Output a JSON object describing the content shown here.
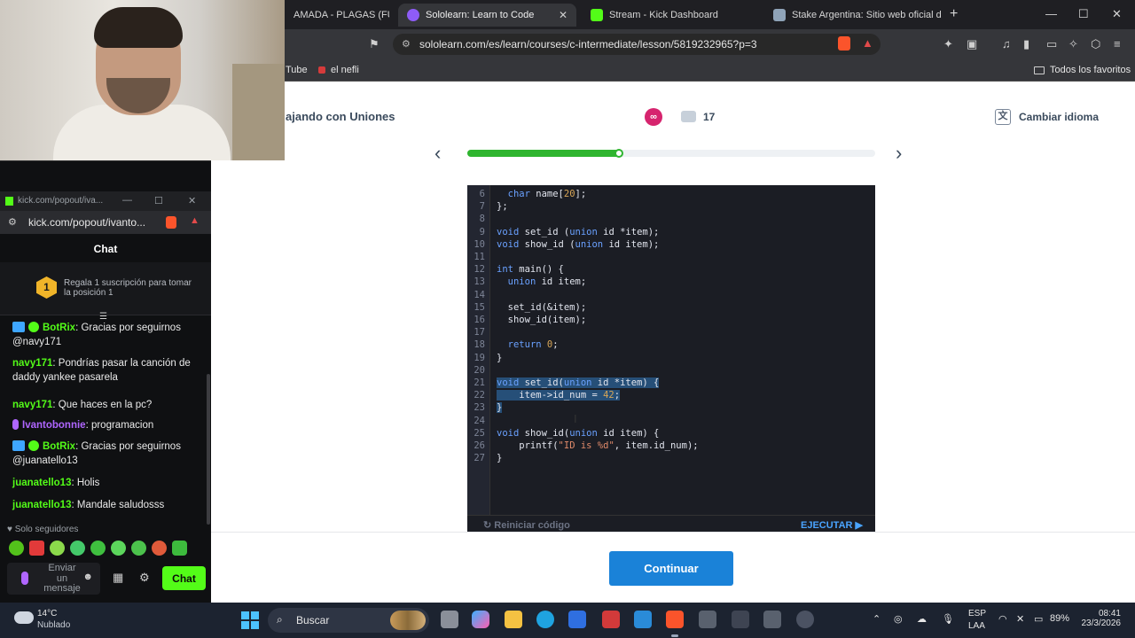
{
  "browser": {
    "tabs": [
      {
        "label": "AMADA - PLAGAS (FULL A",
        "active": false
      },
      {
        "label": "Sololearn: Learn to Code",
        "active": true
      },
      {
        "label": "Stream - Kick Dashboard",
        "active": false
      },
      {
        "label": "Stake Argentina: Sitio web oficial de c",
        "active": false
      }
    ],
    "tab_close": "✕",
    "new_tab": "+",
    "window_controls": {
      "minimize": "—",
      "maximize": "☐",
      "close": "✕"
    },
    "url": "sololearn.com/es/learn/courses/c-intermediate/lesson/5819232965?p=3",
    "bookmarks": [
      "Tube",
      "el nefli"
    ],
    "all_bookmarks_label": "Todos los favoritos"
  },
  "lesson": {
    "title": "ajando con Uniones",
    "heart_symbol": "∞",
    "comment_count": "17",
    "change_language": "Cambiar idioma",
    "prev_symbol": "‹",
    "next_symbol": "›",
    "progress_fraction": 0.373,
    "code_lines": [
      {
        "n": "6",
        "html": "  <span class=\"kw\">char</span> name[<span class=\"num\">20</span>];",
        "sel": false
      },
      {
        "n": "7",
        "html": "};",
        "sel": false
      },
      {
        "n": "8",
        "html": "",
        "sel": false
      },
      {
        "n": "9",
        "html": "<span class=\"kw\">void</span> set_id (<span class=\"kw\">union</span> id *item);",
        "sel": false
      },
      {
        "n": "10",
        "html": "<span class=\"kw\">void</span> show_id (<span class=\"kw\">union</span> id item);",
        "sel": false
      },
      {
        "n": "11",
        "html": "",
        "sel": false
      },
      {
        "n": "12",
        "html": "<span class=\"kw\">int</span> main() {",
        "sel": false
      },
      {
        "n": "13",
        "html": "  <span class=\"kw\">union</span> id item;",
        "sel": false
      },
      {
        "n": "14",
        "html": "",
        "sel": false
      },
      {
        "n": "15",
        "html": "  set_id(&amp;item);",
        "sel": false
      },
      {
        "n": "16",
        "html": "  show_id(item);",
        "sel": false
      },
      {
        "n": "17",
        "html": "",
        "sel": false
      },
      {
        "n": "18",
        "html": "  <span class=\"kw\">return</span> <span class=\"num\">0</span>;",
        "sel": false
      },
      {
        "n": "19",
        "html": "}",
        "sel": false
      },
      {
        "n": "20",
        "html": "",
        "sel": false
      },
      {
        "n": "21",
        "html": "<span class=\"kw\">void</span> set_id(<span class=\"kw\">union</span> id *item) {",
        "sel": true
      },
      {
        "n": "22",
        "html": "    item-&gt;id_num = <span class=\"num\">42</span>;",
        "sel": true
      },
      {
        "n": "23",
        "html": "}",
        "sel": true
      },
      {
        "n": "24",
        "html": "",
        "sel": false
      },
      {
        "n": "25",
        "html": "<span class=\"kw\">void</span> show_id(<span class=\"kw\">union</span> id item) {",
        "sel": false
      },
      {
        "n": "26",
        "html": "    printf(<span class=\"str\">\"ID is %d\"</span>, item.id_num);",
        "sel": false
      },
      {
        "n": "27",
        "html": "}",
        "sel": false
      }
    ],
    "reset_label": "Reiniciar código",
    "run_label": "EJECUTAR",
    "continue_label": "Continuar"
  },
  "chat": {
    "popout_title": "kick.com/popout/iva...",
    "url": "kick.com/popout/ivanto...",
    "header": "Chat",
    "gift_rank": "1",
    "gift_text": "Regala 1 suscripción para tomar la posición 1",
    "messages": [
      {
        "badges": [
          "bot",
          "ver"
        ],
        "user": "BotRix",
        "color": "#53fc18",
        "text": "Gracias por seguirnos @navy171"
      },
      {
        "badges": [],
        "user": "navy171",
        "color": "#53fc18",
        "text": "Pondrías pasar la canción de daddy yankee pasarela"
      },
      {
        "badges": [],
        "user": "navy171",
        "color": "#53fc18",
        "text": "Que haces en la pc?"
      },
      {
        "badges": [
          "mic"
        ],
        "user": "Ivantobonnie",
        "color": "#b066ff",
        "text": "programacion"
      },
      {
        "badges": [
          "bot",
          "ver"
        ],
        "user": "BotRix",
        "color": "#53fc18",
        "text": "Gracias por seguirnos @juanatello13"
      },
      {
        "badges": [],
        "user": "juanatello13",
        "color": "#53fc18",
        "text": "Holis"
      },
      {
        "badges": [],
        "user": "juanatello13",
        "color": "#53fc18",
        "text": "Mandale saludosss"
      }
    ],
    "followers_only": "Solo seguidores",
    "input_placeholder": "Enviar un mensaje",
    "send_label": "Chat"
  },
  "taskbar": {
    "temperature": "14°C",
    "weather": "Nublado",
    "search_label": "Buscar",
    "lang": "ESP",
    "lang_sub": "LAA",
    "battery": "89%",
    "time": "08:41",
    "date": "23/3/2026"
  }
}
